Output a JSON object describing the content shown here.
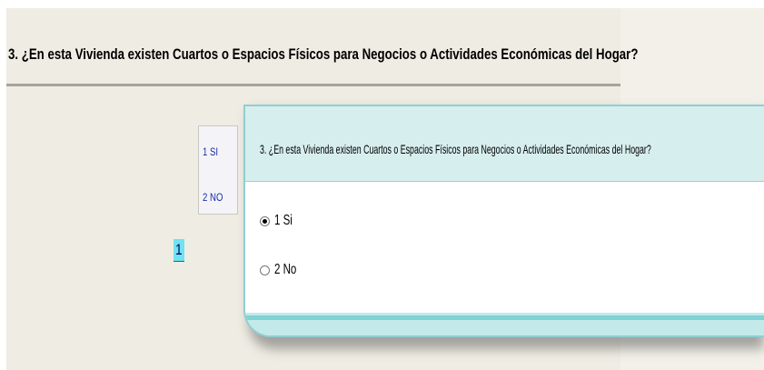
{
  "form": {
    "question": "3. ¿En esta Vivienda existen Cuartos o Espacios Físicos para Negocios o Actividades Económicas del Hogar?",
    "codes": [
      "1 SI",
      "2 NO"
    ],
    "answer_value": "1"
  },
  "dialog": {
    "title": "3. ¿En esta Vivienda existen Cuartos o Espacios Físicos para Negocios o Actividades Económicas del Hogar?",
    "options": [
      {
        "label": "1 Si",
        "selected": true
      },
      {
        "label": "2 No",
        "selected": false
      }
    ]
  },
  "colors": {
    "form_background": "#efece3",
    "answer_highlight": "#70e3f0",
    "dialog_accent": "#8fcfd1",
    "code_text": "#1a2aa8"
  },
  "icons": [
    "radio-selected-icon",
    "radio-unselected-icon"
  ]
}
